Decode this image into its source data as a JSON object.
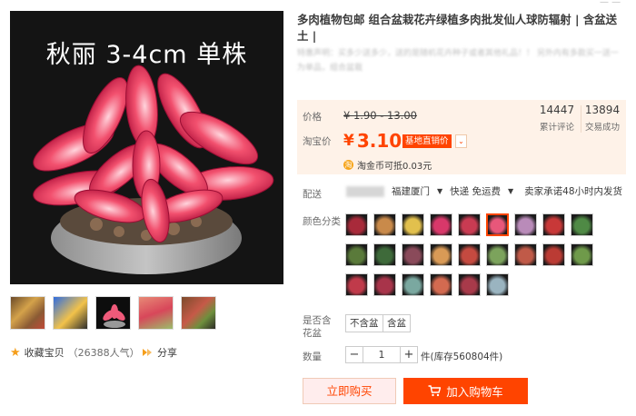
{
  "gallery": {
    "caption": "秋丽 3-4cm 单株",
    "favorite_label": "收藏宝贝",
    "favorite_count": "（26388人气）",
    "share_label": "分享"
  },
  "product": {
    "title": "多肉植物包邮 组合盆栽花卉绿植多肉批发仙人球防辐射 | 含盆送土 |",
    "subtitle_line1": "特惠声明：买多少送多少，送的是随机花卉种子或者其他礼品！！ 另外内有多款买一送一",
    "subtitle_line2": "为单品，组合盆栽"
  },
  "price": {
    "label_price": "价格",
    "original": "¥ 1.90 - 13.00",
    "label_taobao": "淘宝价",
    "currency": "¥",
    "current": "3.10",
    "tag": "基地直销价",
    "reviews_count": "14447",
    "reviews_label": "累计评论",
    "deals_count": "13894",
    "deals_label": "交易成功",
    "coin_text": "淘金币可抵",
    "coin_value": "0.03元",
    "coin_icon": "淘"
  },
  "shipping": {
    "label": "配送",
    "from": "福建厦门",
    "express": "快递 免运费",
    "promise": "卖家承诺48小时内发货"
  },
  "color": {
    "label": "颜色分类",
    "swatch_colors": [
      "#a82a3a",
      "#c98a4a",
      "#e2c04d",
      "#d8386a",
      "#c93b52",
      "#e8577a",
      "#b98bb9",
      "#c83838",
      "#4f8a45",
      "#5a7a3a",
      "#3e6a3a",
      "#8a4a5a",
      "#d99a56",
      "#c54a40",
      "#7ca35c",
      "#c05a48",
      "#bb3b34",
      "#6f9a4a",
      "#c03a4a",
      "#a8344a",
      "#7aa8a0",
      "#d36a50",
      "#a83a4a",
      "#9ab4c0"
    ]
  },
  "pot": {
    "label": "是否含花盆",
    "options": [
      "不含盆",
      "含盆"
    ]
  },
  "quantity": {
    "label": "数量",
    "value": "1",
    "stock": "件(库存560804件)",
    "minus": "−",
    "plus": "+"
  },
  "actions": {
    "buy_now": "立即购买",
    "add_cart": "加入购物车"
  },
  "colors": {
    "accent": "#ff4400",
    "price_bg": "#fef2e8"
  }
}
